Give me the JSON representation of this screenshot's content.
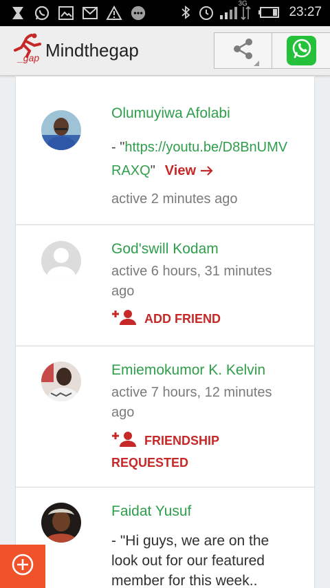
{
  "status_bar": {
    "time": "23:27",
    "network_label": "3G",
    "icons": [
      "notification-x-icon",
      "whatsapp-notification-icon",
      "image-notification-icon",
      "email-notification-icon",
      "warning-icon",
      "chat-bubble-icon",
      "bluetooth-icon",
      "alarm-icon",
      "signal-icon",
      "battery-icon"
    ]
  },
  "app_bar": {
    "title": "Mindthegap",
    "logo_text": "_gap",
    "share_icon": "share-icon",
    "whatsapp_icon": "whatsapp-icon"
  },
  "colors": {
    "name_green": "#2e9e4b",
    "action_red": "#c62828",
    "fab_orange": "#f0532a",
    "whatsapp_green": "#25c13a"
  },
  "members": [
    {
      "name": "Olumuyiwa Afolabi",
      "update_prefix": "- \"",
      "update_link": "https://youtu.be/D8BnUMVRAXQ",
      "update_suffix": "\"",
      "view_label": "View",
      "activity": "active 2 minutes ago"
    },
    {
      "name": "God'swill Kodam",
      "activity": "active 6 hours, 31 minutes ago",
      "action_label": "ADD FRIEND"
    },
    {
      "name": "Emiemokumor K. Kelvin",
      "activity": "active 7 hours, 12 minutes ago",
      "action_label": "FRIENDSHIP REQUESTED"
    },
    {
      "name": "Faidat Yusuf",
      "update_text": "- \"Hi guys, we are on the look out for our featured member for this week.."
    }
  ],
  "fab": {
    "icon": "add-circle-icon"
  }
}
